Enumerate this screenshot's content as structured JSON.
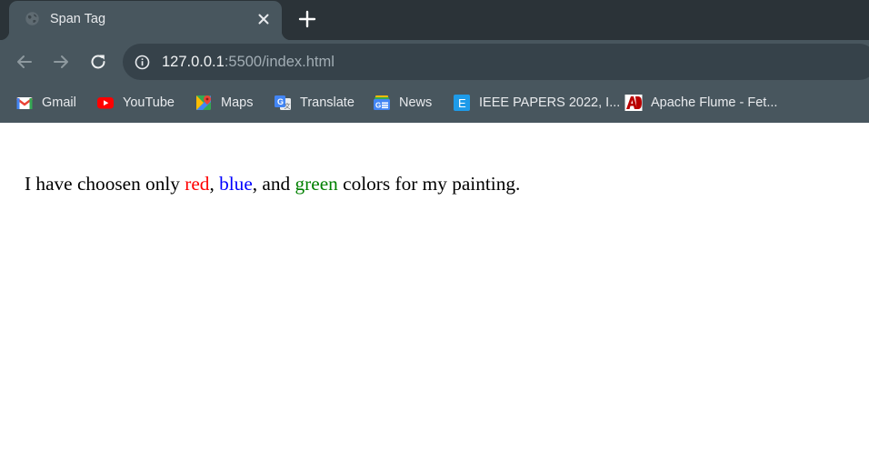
{
  "browser": {
    "tab": {
      "title": "Span Tag"
    },
    "address": {
      "host": "127.0.0.1",
      "path": ":5500/index.html"
    },
    "bookmarks": [
      {
        "label": "Gmail",
        "icon": "gmail-icon"
      },
      {
        "label": "YouTube",
        "icon": "youtube-icon"
      },
      {
        "label": "Maps",
        "icon": "maps-icon"
      },
      {
        "label": "Translate",
        "icon": "translate-icon"
      },
      {
        "label": "News",
        "icon": "news-icon"
      },
      {
        "label": "IEEE PAPERS 2022, I...",
        "icon": "ieee-icon"
      },
      {
        "label": "Apache Flume - Fet...",
        "icon": "apache-flume-icon"
      }
    ]
  },
  "content": {
    "segments": [
      {
        "text": "I have choosen only ",
        "color": "#000000"
      },
      {
        "text": "red",
        "color": "#ff0000"
      },
      {
        "text": ", ",
        "color": "#000000"
      },
      {
        "text": "blue",
        "color": "#0000ff"
      },
      {
        "text": ", and ",
        "color": "#000000"
      },
      {
        "text": "green",
        "color": "#008000"
      },
      {
        "text": " colors for my painting.",
        "color": "#000000"
      }
    ]
  },
  "theme": {
    "tabstrip": "#2b3338",
    "toolbar": "#48565e",
    "omnibox": "#36424a"
  }
}
